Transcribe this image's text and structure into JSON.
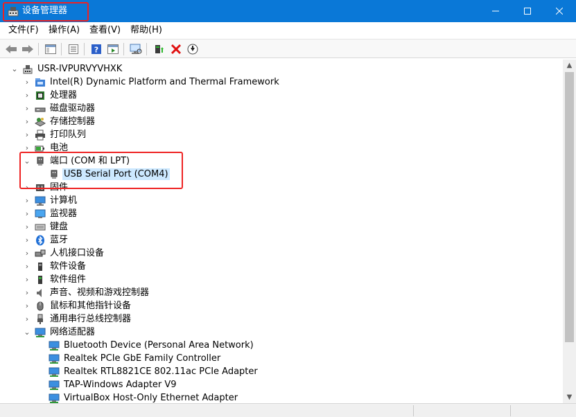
{
  "window": {
    "title": "设备管理器",
    "controls": {
      "minimize_icon": "minimize-icon",
      "maximize_icon": "maximize-icon",
      "close_icon": "close-icon"
    }
  },
  "menu": [
    "文件(F)",
    "操作(A)",
    "查看(V)",
    "帮助(H)"
  ],
  "toolbar": [
    "back-arrow-icon",
    "forward-arrow-icon",
    "show-hide-console-tree-icon",
    "properties-icon",
    "help-icon",
    "action-pane-icon",
    "scan-hardware-icon",
    "update-driver-icon",
    "uninstall-icon",
    "disable-device-icon"
  ],
  "tree": {
    "root": "USR-IVPURVYVHXK",
    "categories": [
      {
        "label": "Intel(R) Dynamic Platform and Thermal Framework",
        "icon": "chip-folder-icon"
      },
      {
        "label": "处理器",
        "icon": "processor-icon"
      },
      {
        "label": "磁盘驱动器",
        "icon": "disk-drive-icon"
      },
      {
        "label": "存储控制器",
        "icon": "storage-controller-icon"
      },
      {
        "label": "打印队列",
        "icon": "printer-icon"
      },
      {
        "label": "电池",
        "icon": "battery-icon"
      },
      {
        "label": "端口 (COM 和 LPT)",
        "icon": "port-icon",
        "expanded": true,
        "children": [
          {
            "label": "USB Serial Port (COM4)",
            "icon": "port-icon",
            "selected": true
          }
        ]
      },
      {
        "label": "固件",
        "icon": "firmware-icon"
      },
      {
        "label": "计算机",
        "icon": "computer-icon"
      },
      {
        "label": "监视器",
        "icon": "monitor-icon"
      },
      {
        "label": "键盘",
        "icon": "keyboard-icon"
      },
      {
        "label": "蓝牙",
        "icon": "bluetooth-icon"
      },
      {
        "label": "人机接口设备",
        "icon": "hid-icon"
      },
      {
        "label": "软件设备",
        "icon": "software-device-icon"
      },
      {
        "label": "软件组件",
        "icon": "software-component-icon"
      },
      {
        "label": "声音、视频和游戏控制器",
        "icon": "sound-icon"
      },
      {
        "label": "鼠标和其他指针设备",
        "icon": "mouse-icon"
      },
      {
        "label": "通用串行总线控制器",
        "icon": "usb-icon"
      },
      {
        "label": "网络适配器",
        "icon": "network-icon",
        "expanded": true,
        "children": [
          {
            "label": "Bluetooth Device (Personal Area Network)",
            "icon": "network-adapter-icon"
          },
          {
            "label": "Realtek PCIe GbE Family Controller",
            "icon": "network-adapter-icon"
          },
          {
            "label": "Realtek RTL8821CE 802.11ac PCIe Adapter",
            "icon": "network-adapter-icon"
          },
          {
            "label": "TAP-Windows Adapter V9",
            "icon": "network-adapter-icon"
          },
          {
            "label": "VirtualBox Host-Only Ethernet Adapter",
            "icon": "network-adapter-icon"
          }
        ]
      }
    ]
  },
  "colors": {
    "titlebar": "#0a78d7",
    "selection": "#cce8ff",
    "highlight_box": "#e22222"
  }
}
